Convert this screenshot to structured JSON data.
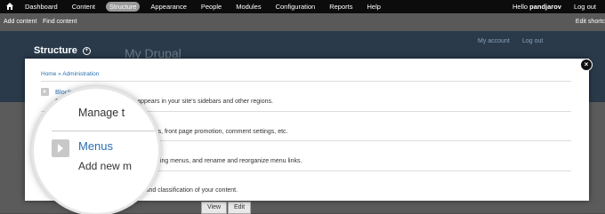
{
  "toolbar": {
    "items": [
      {
        "label": "Dashboard"
      },
      {
        "label": "Content"
      },
      {
        "label": "Structure"
      },
      {
        "label": "Appearance"
      },
      {
        "label": "People"
      },
      {
        "label": "Modules"
      },
      {
        "label": "Configuration"
      },
      {
        "label": "Reports"
      },
      {
        "label": "Help"
      }
    ],
    "active": "Structure",
    "hello_prefix": "Hello",
    "username": "pandjarov",
    "logout": "Log out"
  },
  "shortcuts": {
    "add_content": "Add content",
    "find_content": "Find content",
    "edit_shortcuts": "Edit shortc"
  },
  "header": {
    "title": "Structure",
    "site_name": "My Drupal",
    "my_account": "My account",
    "log_out": "Log out"
  },
  "dialog": {
    "breadcrumb": "Home » Administration",
    "items": [
      {
        "name": "Blocks",
        "desc": "Configure what block content appears in your site's sidebars and other regions."
      },
      {
        "name": "",
        "desc": "Manage types, including default status, front page promotion, comment settings, etc."
      },
      {
        "name": "",
        "desc": "Add new menus to your site, edit existing menus, and rename and reorganize menu links."
      },
      {
        "name": "",
        "desc": "Manage tagging, categorization, and classification of your content."
      }
    ],
    "close_symbol": "×"
  },
  "magnifier": {
    "line1": "Manage t",
    "item_name": "Menus",
    "item_desc": "Add new m"
  },
  "lower_buttons": {
    "view": "View",
    "edit": "Edit"
  }
}
